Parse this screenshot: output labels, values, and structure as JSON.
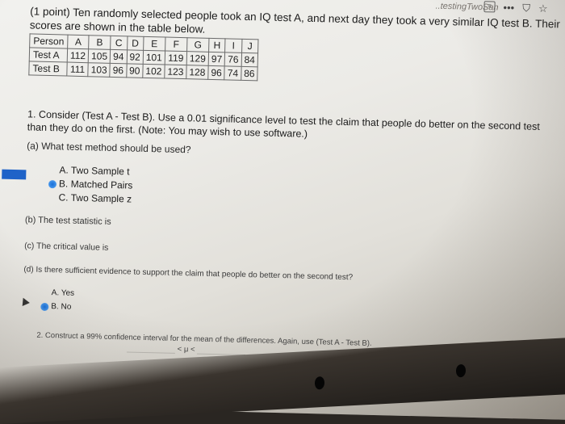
{
  "browser": {
    "tab_fragment": "..testingTwoSan",
    "icons": [
      "reader-view-icon",
      "more-dots-icon",
      "pocket-icon",
      "bookmark-star-icon"
    ]
  },
  "problem": {
    "intro": "(1 point) Ten randomly selected people took an IQ test A, and next day they took a very similar IQ test B. Their scores are shown in the table below.",
    "table": {
      "header": [
        "Person",
        "A",
        "B",
        "C",
        "D",
        "E",
        "F",
        "G",
        "H",
        "I",
        "J"
      ],
      "rows": [
        [
          "Test A",
          "112",
          "105",
          "94",
          "92",
          "101",
          "119",
          "129",
          "97",
          "76",
          "84"
        ],
        [
          "Test B",
          "111",
          "103",
          "96",
          "90",
          "102",
          "123",
          "128",
          "96",
          "74",
          "86"
        ]
      ]
    },
    "q1": {
      "text": "1. Consider (Test A - Test B). Use a 0.01 significance level to test the claim that people do better on the second test than they do on the first. (Note: You may wish to use software.)",
      "part_a": "(a) What test method should be used?",
      "options": [
        {
          "label": "A. Two Sample t",
          "selected": false
        },
        {
          "label": "B. Matched Pairs",
          "selected": true
        },
        {
          "label": "C. Two Sample z",
          "selected": false
        }
      ],
      "part_b": "(b) The test statistic is",
      "part_c": "(c) The critical value is",
      "part_d": "(d) Is there sufficient evidence to support the claim that people do better on the second test?",
      "options_d": [
        {
          "label": "A. Yes",
          "selected": false
        },
        {
          "label": "B. No",
          "selected": true
        }
      ]
    },
    "q2": {
      "text": "2. Construct a 99% confidence interval for the mean of the differences. Again, use (Test A - Test B).",
      "interval": "< μ <"
    }
  },
  "colors": {
    "radio_selected": "#1a6fd6",
    "side_marker": "#1f63c8"
  }
}
